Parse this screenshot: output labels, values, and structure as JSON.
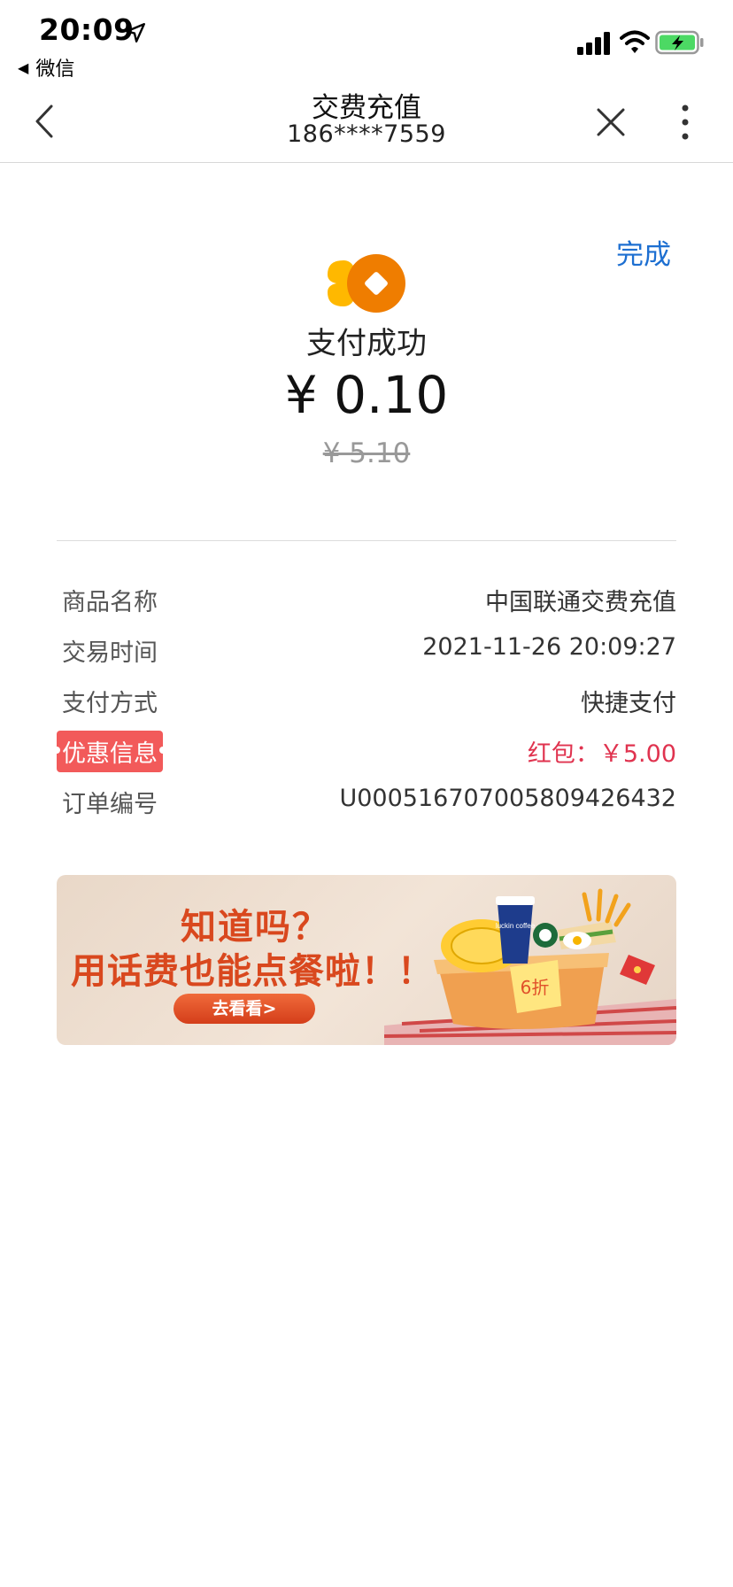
{
  "status_bar": {
    "time": "20:09",
    "back_app": "微信"
  },
  "header": {
    "title": "交费充值",
    "subtitle": "186****7559"
  },
  "payment": {
    "done_label": "完成",
    "status": "支付成功",
    "amount": "¥ 0.10",
    "original_amount": "¥ 5.10"
  },
  "details": [
    {
      "label": "商品名称",
      "value": "中国联通交费充值"
    },
    {
      "label": "交易时间",
      "value": "2021-11-26 20:09:27"
    },
    {
      "label": "支付方式",
      "value": "快捷支付"
    },
    {
      "label": "优惠信息",
      "value": "红包：￥5.00"
    },
    {
      "label": "订单编号",
      "value": "U000516707005809426432"
    }
  ],
  "banner": {
    "line1": "知道吗？",
    "line2": "用话费也能点餐啦！！",
    "button": "去看看>",
    "tag": "6折",
    "cup_text": "luckin coffee"
  },
  "colors": {
    "accent_blue": "#1d6fd1",
    "promo_red": "#e0334f",
    "logo_orange": "#ef7d00"
  }
}
